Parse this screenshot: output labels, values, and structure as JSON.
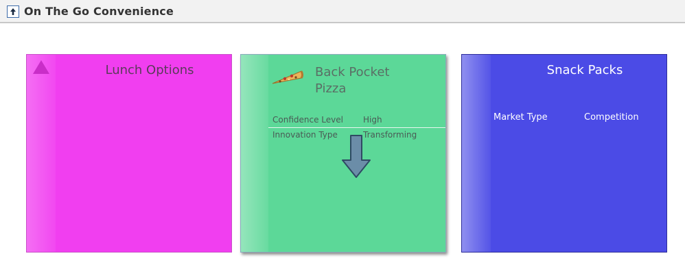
{
  "header": {
    "title": "On The Go Convenience"
  },
  "cards": {
    "lunch": {
      "title": "Lunch Options",
      "color": "#f13ef0"
    },
    "pizza": {
      "title_line1": "Back Pocket",
      "title_line2": "Pizza",
      "icon": "pizza-slice-icon",
      "color": "#5cd898",
      "fields": [
        {
          "label": "Confidence Level",
          "value": "High"
        },
        {
          "label": "Innovation Type",
          "value": "Transforming"
        }
      ]
    },
    "snack": {
      "title": "Snack Packs",
      "color": "#4b4be6",
      "fields": [
        {
          "label": "Market Type"
        },
        {
          "label": "Competition"
        }
      ]
    }
  }
}
